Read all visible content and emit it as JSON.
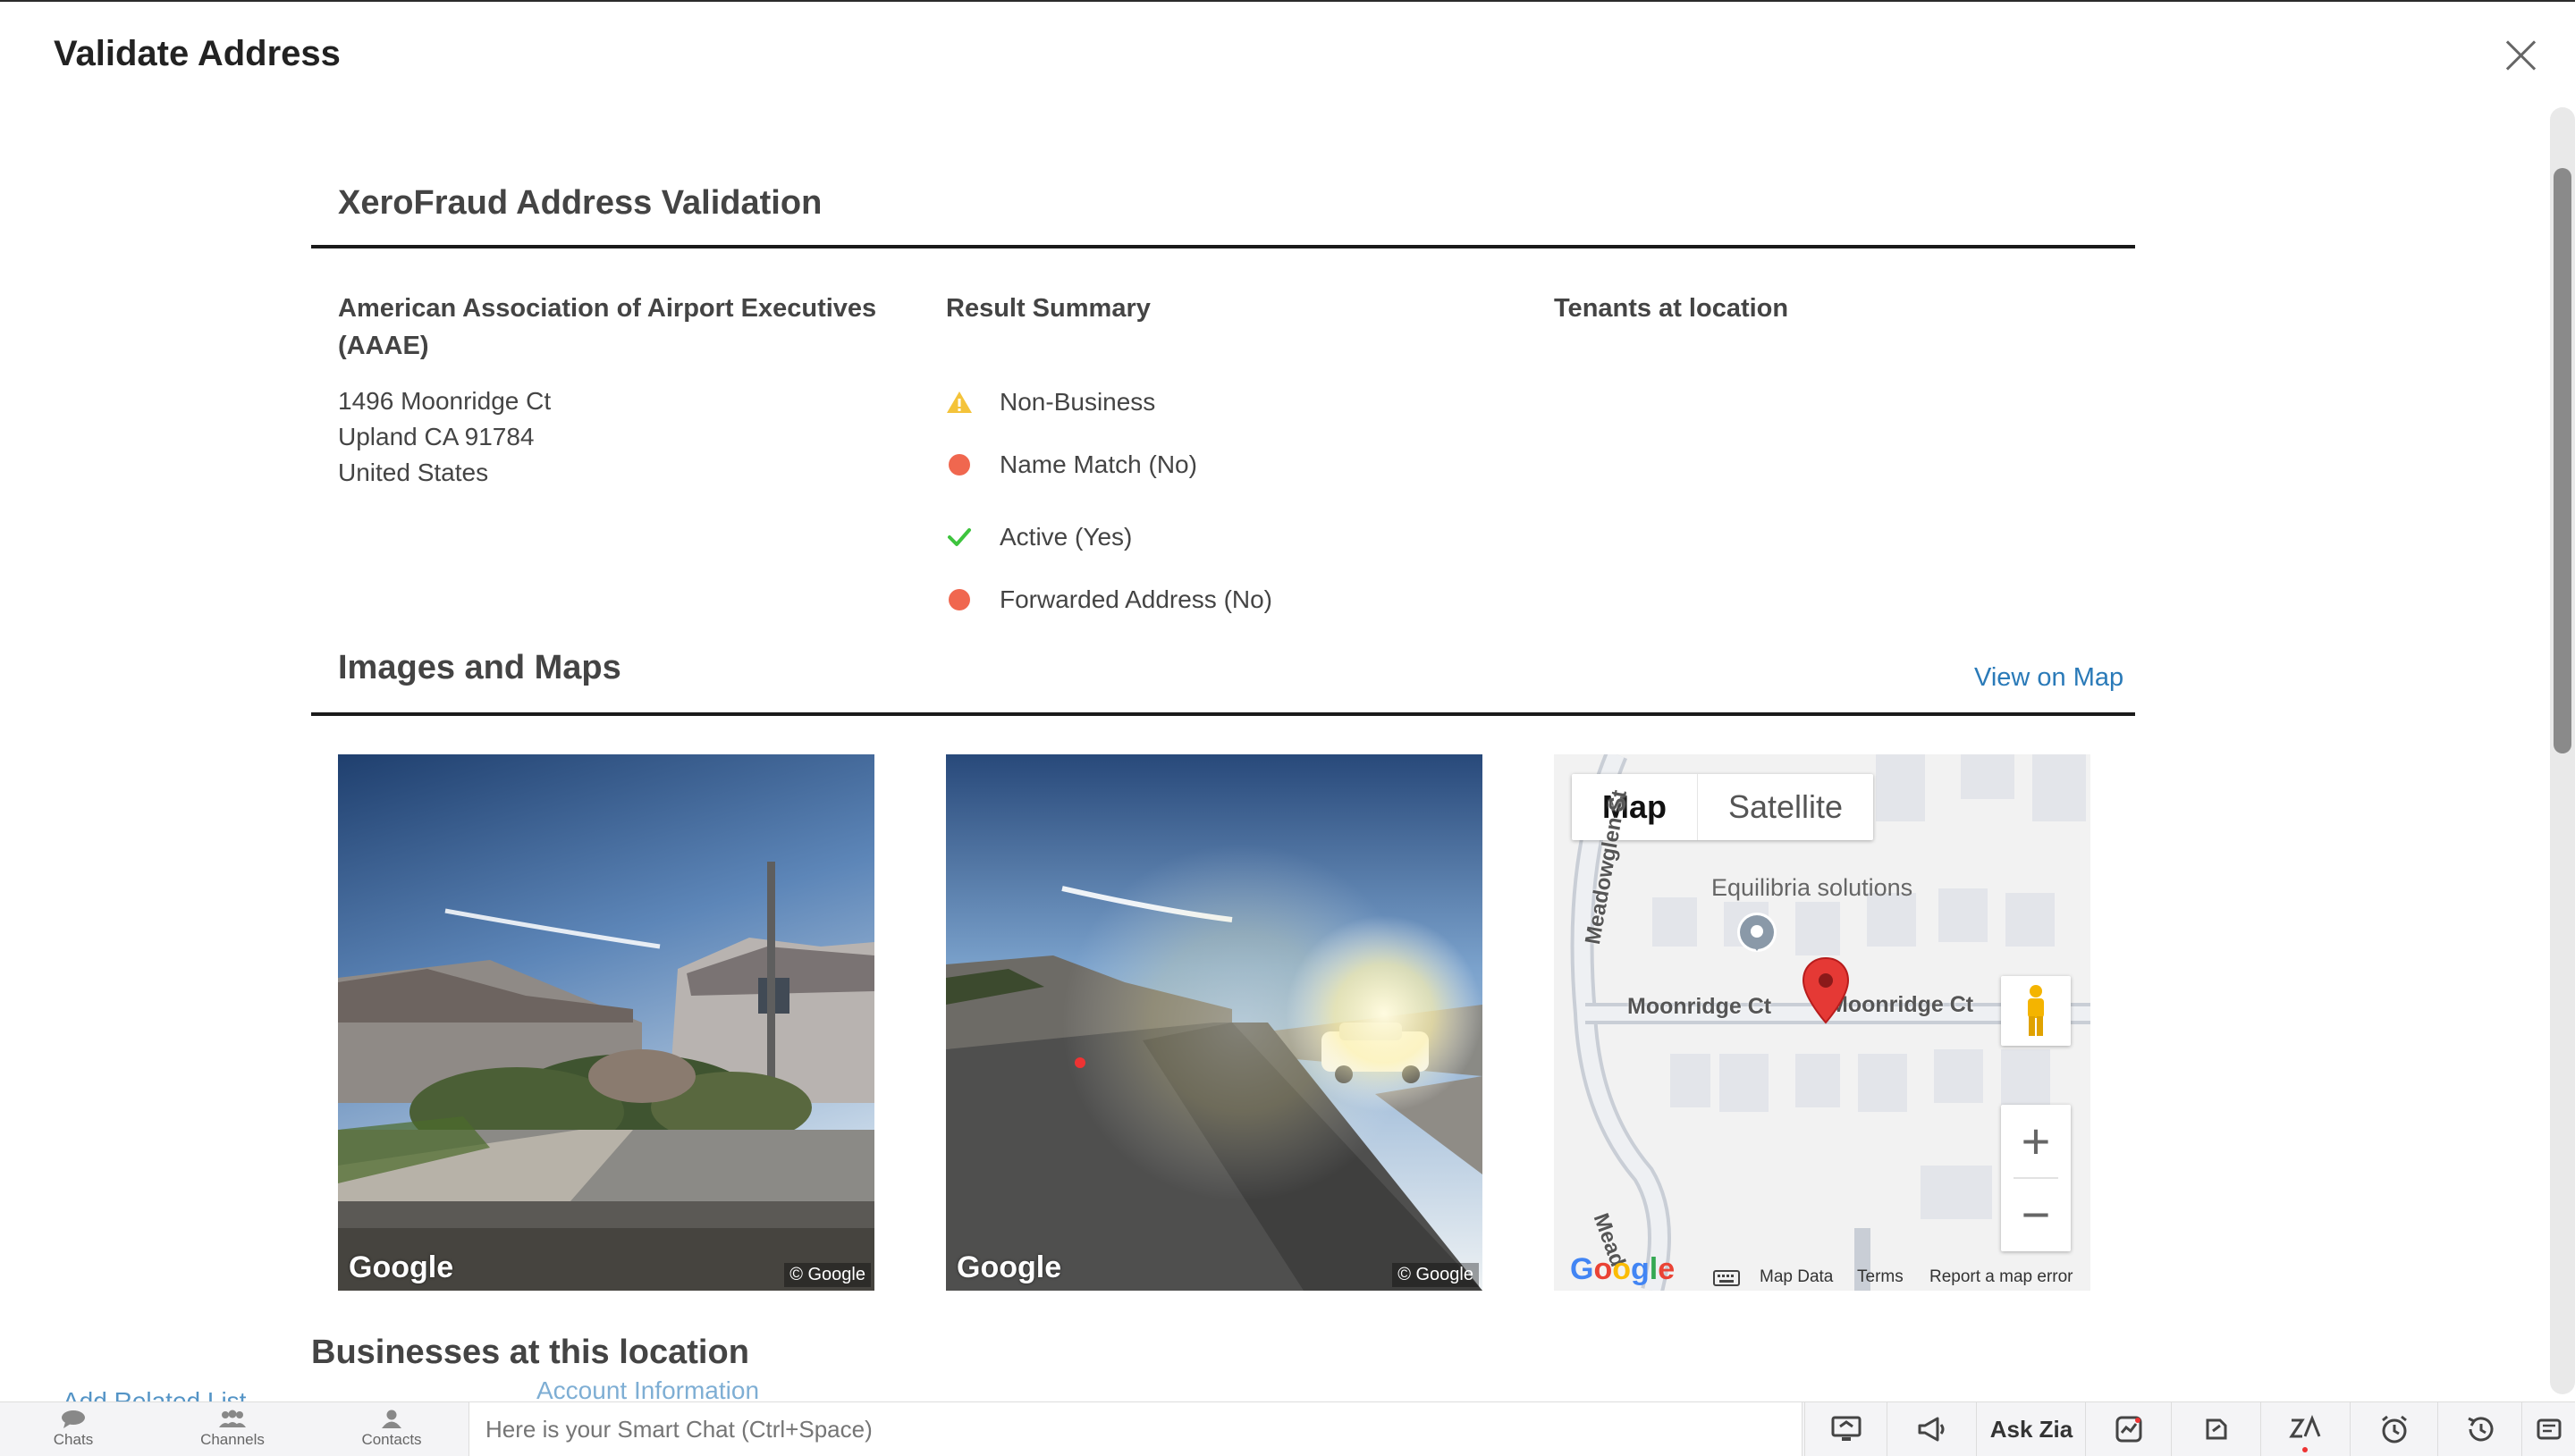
{
  "modal": {
    "title": "Validate Address"
  },
  "report": {
    "heading": "XeroFraud Address Validation",
    "business": {
      "name_line1": "American Association of Airport Executives",
      "name_line2": "(AAAE)",
      "address": [
        "1496 Moonridge Ct",
        "Upland CA 91784",
        "United States"
      ]
    },
    "result_summary": {
      "heading": "Result Summary",
      "items": [
        {
          "label": "Non-Business",
          "status": "warning",
          "icon": "warning-icon",
          "color": "#f4c33a"
        },
        {
          "label": "Name Match (No)",
          "status": "fail",
          "icon": "red-dot-icon",
          "color": "#f0674f"
        },
        {
          "label": "Active (Yes)",
          "status": "pass",
          "icon": "check-icon",
          "color": "#3ec43e"
        },
        {
          "label": "Forwarded Address (No)",
          "status": "fail",
          "icon": "red-dot-icon",
          "color": "#f0674f"
        }
      ]
    },
    "tenants": {
      "heading": "Tenants at location"
    }
  },
  "images_maps": {
    "heading": "Images and Maps",
    "view_link": "View on Map",
    "photos": [
      {
        "logo": "Google",
        "copyright": "© Google"
      },
      {
        "logo": "Google",
        "copyright": "© Google"
      }
    ],
    "map": {
      "type_map": "Map",
      "type_satellite": "Satellite",
      "selected_type": "Map",
      "poi": "Equilibria solutions",
      "streets": [
        "Meadowglen St",
        "Moonridge Ct",
        "Moonridge Ct",
        "Mead"
      ],
      "zoom_in": "+",
      "zoom_out": "−",
      "logo": "Google",
      "footer": {
        "data": "Map Data",
        "terms": "Terms",
        "report": "Report a map error"
      }
    }
  },
  "businesses": {
    "heading": "Businesses at this location"
  },
  "behind_modal": {
    "add_related": "Add Related List",
    "account_info": "Account Information"
  },
  "bottom_bar": {
    "nav": [
      {
        "label": "Chats",
        "icon": "chat-icon"
      },
      {
        "label": "Channels",
        "icon": "channels-icon"
      },
      {
        "label": "Contacts",
        "icon": "contacts-icon"
      }
    ],
    "smart_chat_placeholder": "Here is your Smart Chat (Ctrl+Space)",
    "ask_zia": "Ask Zia"
  },
  "colors": {
    "accent_link": "#2a7ab8",
    "rule": "#1a1a1a",
    "marker": "#e53935"
  }
}
